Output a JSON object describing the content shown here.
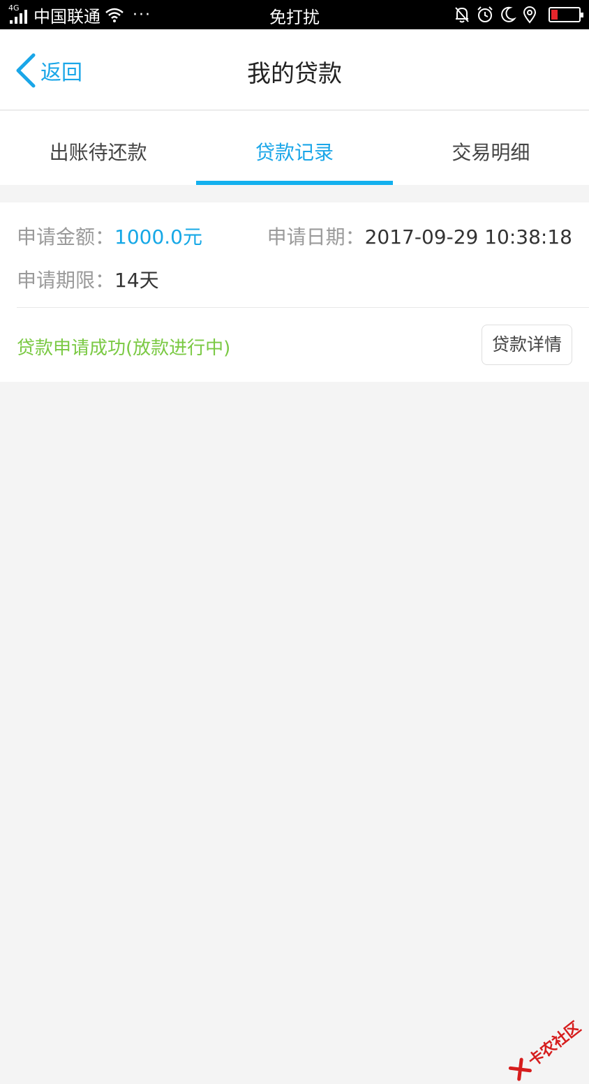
{
  "status_bar": {
    "network_type": "4G",
    "carrier": "中国联通",
    "more": "···",
    "mode_label": "免打扰",
    "battery_color": "#e6262c"
  },
  "navbar": {
    "back_label": "返回",
    "title": "我的贷款"
  },
  "tabs": [
    {
      "label": "出账待还款",
      "active": false
    },
    {
      "label": "贷款记录",
      "active": true
    },
    {
      "label": "交易明细",
      "active": false
    }
  ],
  "loan_record": {
    "amount_label": "申请金额：",
    "amount_value": "1000.0元",
    "date_label": "申请日期：",
    "date_value": "2017-09-29 10:38:18",
    "term_label": "申请期限：",
    "term_value": "14天",
    "status_text": "贷款申请成功(放款进行中)",
    "detail_button": "贷款详情"
  },
  "watermark": {
    "text": "卡农社区"
  },
  "colors": {
    "accent": "#1aa6e8",
    "tab_underline": "#13b0ee",
    "status_green": "#7ac943",
    "background": "#f4f4f4"
  }
}
